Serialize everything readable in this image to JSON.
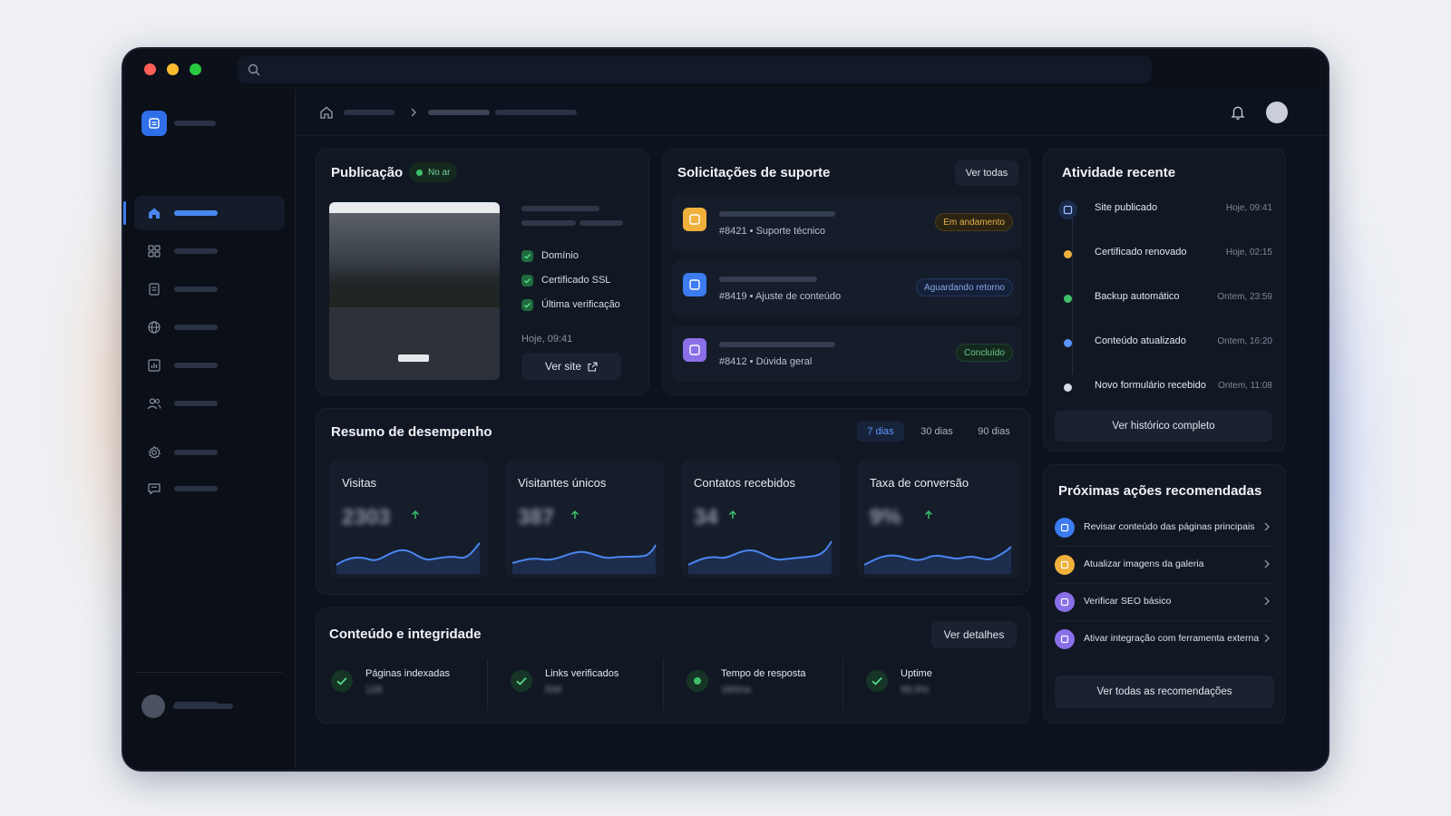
{
  "colors": {
    "accent": "#3d7cf0",
    "success": "#3fbf6a",
    "warning": "#f0b13c",
    "purple": "#8a6fe8"
  },
  "publicacao": {
    "title": "Publicação",
    "status": "No ar",
    "checks": [
      "Domínio",
      "Certificado SSL",
      "Última verificação"
    ],
    "timestamp": "Hoje, 09:41",
    "button": "Ver site"
  },
  "suporte": {
    "title": "Solicitações de suporte",
    "button": "Ver todas",
    "tickets": [
      {
        "id": "#8421",
        "category": "Suporte técnico",
        "status": "Em andamento",
        "icon": "ticket-icon"
      },
      {
        "id": "#8419",
        "category": "Ajuste de conteúdo",
        "status": "Aguardando retorno",
        "icon": "ticket-icon"
      },
      {
        "id": "#8412",
        "category": "Dúvida geral",
        "status": "Concluído",
        "icon": "ticket-icon"
      }
    ]
  },
  "atividade": {
    "title": "Atividade recente",
    "items": [
      {
        "label": "Site publicado",
        "time": "Hoje, 09:41"
      },
      {
        "label": "Certificado renovado",
        "time": "Hoje, 02:15"
      },
      {
        "label": "Backup automático",
        "time": "Ontem, 23:59"
      },
      {
        "label": "Conteúdo atualizado",
        "time": "Ontem, 16:20"
      },
      {
        "label": "Novo formulário recebido",
        "time": "Ontem, 11:08"
      }
    ],
    "button": "Ver histórico completo"
  },
  "desempenho": {
    "title": "Resumo de desempenho",
    "tabs": [
      "7 dias",
      "30 dias",
      "90 dias"
    ],
    "active_tab": "7 dias",
    "metrics": [
      {
        "label": "Visitas",
        "value": "2303",
        "trend": "up"
      },
      {
        "label": "Visitantes únicos",
        "value": "387",
        "trend": "up"
      },
      {
        "label": "Contatos recebidos",
        "value": "34",
        "trend": "up"
      },
      {
        "label": "Taxa de conversão",
        "value": "9%",
        "trend": "up"
      }
    ]
  },
  "integridade": {
    "title": "Conteúdo e integridade",
    "button": "Ver detalhes",
    "items": [
      {
        "label": "Páginas indexadas",
        "value": "128"
      },
      {
        "label": "Links verificados",
        "value": "596"
      },
      {
        "label": "Tempo de resposta",
        "value": "180ms"
      },
      {
        "label": "Uptime",
        "value": "99,9%"
      }
    ]
  },
  "recomendacoes": {
    "title": "Próximas ações recomendadas",
    "items": [
      {
        "label": "Revisar conteúdo das páginas principais",
        "color": "#3d7cf0"
      },
      {
        "label": "Atualizar imagens da galeria",
        "color": "#f0b13c"
      },
      {
        "label": "Verificar SEO básico",
        "color": "#8a6fe8"
      },
      {
        "label": "Ativar integração com ferramenta externa",
        "color": "#8a6fe8"
      }
    ],
    "button": "Ver todas as recomendações"
  }
}
